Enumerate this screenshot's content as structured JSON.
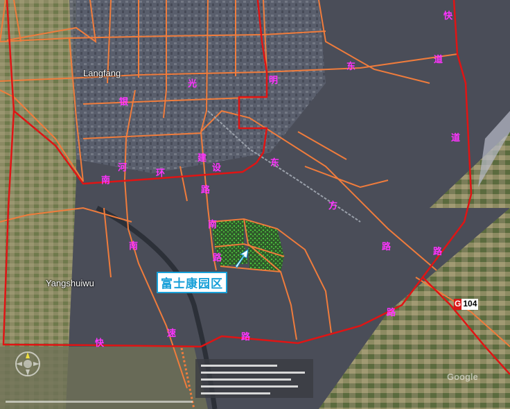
{
  "map": {
    "colors": {
      "ring_road": "#e01414",
      "road": "#f07c3c",
      "road_label": "#ff33ff",
      "park_area": "#3b7a2c",
      "callout": "#18a0d8"
    },
    "places": {
      "langfang": "Langfang",
      "yangshuiwu": "Yangshuiwu"
    },
    "road_labels": {
      "guang": "光",
      "ming": "明",
      "dong": "东",
      "dao_east": "道",
      "yin": "银",
      "he": "河",
      "nan_yinhe": "南",
      "lu_yinhe": "路",
      "huan": "环",
      "jian": "建",
      "she": "设",
      "nan_jianshe": "南",
      "lu_jianshe": "路",
      "nan_yinhe2": "南",
      "dong_east": "东",
      "fang_east": "方",
      "lu_east": "路",
      "kuai_top": "快",
      "dao_right": "道",
      "lu_right": "路",
      "kuai_bottom": "快",
      "su": "速",
      "lu_bottom": "路",
      "lu_bottom2": "路"
    },
    "callout": "富士康园区",
    "highway": {
      "prefix": "G",
      "number": "104"
    },
    "watermark": "Google"
  }
}
